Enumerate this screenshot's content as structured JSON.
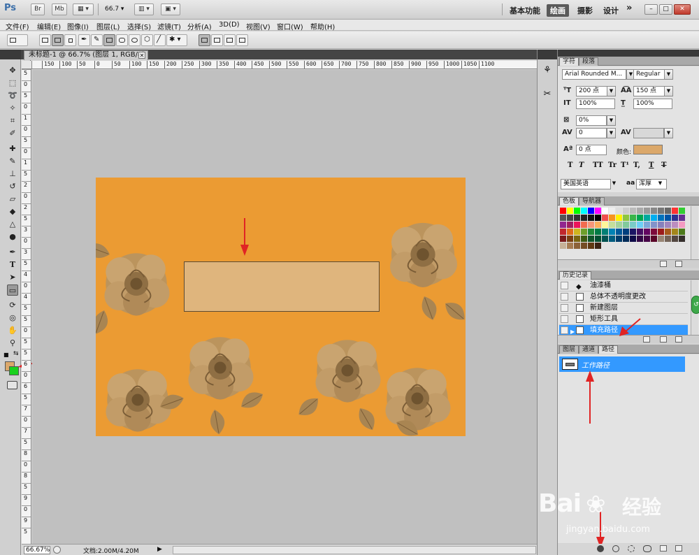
{
  "app": {
    "logo": "Ps",
    "bar_buttons": [
      "Br",
      "Mb"
    ],
    "zoom": "66.7",
    "workspaces": [
      "基本功能",
      "绘画",
      "摄影",
      "设计"
    ],
    "active_workspace": "绘画",
    "more": "»",
    "window_controls": [
      "–",
      "□",
      "✕"
    ]
  },
  "menu": [
    "文件(F)",
    "编辑(E)",
    "图像(I)",
    "图层(L)",
    "选择(S)",
    "滤镜(T)",
    "分析(A)",
    "3D(D)",
    "视图(V)",
    "窗口(W)",
    "帮助(H)"
  ],
  "document": {
    "tab_title": "未标题-1 @ 66.7% (图层 1, RGB/8) *",
    "close": "✕",
    "status_zoom": "66.67%",
    "doc_info": "文档:2.00M/4.20M",
    "ruler_labels": [
      "150",
      "100",
      "50",
      "0",
      "50",
      "100",
      "150",
      "200",
      "250",
      "300",
      "350",
      "400",
      "450",
      "500",
      "550",
      "600",
      "650",
      "700",
      "750",
      "800",
      "850",
      "900",
      "950",
      "1000",
      "1050",
      "1100"
    ],
    "ruler_left_labels": [
      "5",
      "0",
      "5",
      "0",
      "1",
      "0",
      "5",
      "0",
      "1",
      "5",
      "2",
      "0",
      "2",
      "5",
      "3",
      "0",
      "3",
      "5",
      "4",
      "0",
      "4",
      "5",
      "5",
      "0",
      "5",
      "5",
      "6",
      "0",
      "6",
      "5",
      "7",
      "0",
      "7",
      "5",
      "8",
      "0",
      "8",
      "5",
      "9",
      "0",
      "9",
      "5"
    ]
  },
  "colors": {
    "canvas_bg": "#eb9b33",
    "shape_fill": "#dfb57d",
    "foreground": "#dba86a",
    "background": "#19d11d",
    "selection": "#3399ff",
    "flowers": "#b8925a"
  },
  "character": {
    "tabs": [
      "字符",
      "段落"
    ],
    "active_tab": "字符",
    "font_family": "Arial Rounded M...",
    "font_style": "Regular",
    "size": "200 点",
    "leading": "150 点",
    "vscale": "100%",
    "hscale": "100%",
    "tsume": "0%",
    "kerning": "0",
    "tracking": "",
    "baseline": "0 点",
    "color_label": "颜色:",
    "style_buttons": [
      "T",
      "T",
      "TT",
      "Tr",
      "T¹",
      "T,",
      "T",
      "T"
    ],
    "language": "美国英语",
    "aa_label": "aa",
    "antialias": "浑厚"
  },
  "swatches": {
    "tabs": [
      "色板",
      "导航器"
    ],
    "active_tab": "色板"
  },
  "history": {
    "title": "历史记录",
    "items": [
      "油漆桶",
      "总体不透明度更改",
      "新建图层",
      "矩形工具",
      "填充路径"
    ],
    "selected": 4
  },
  "paths": {
    "tabs": [
      "图层",
      "通道",
      "路径"
    ],
    "active_tab": "路径",
    "item": "工作路径"
  },
  "watermark": {
    "brand": "Bai",
    "brand2": "经验",
    "url": "jingyan.baidu.com"
  }
}
